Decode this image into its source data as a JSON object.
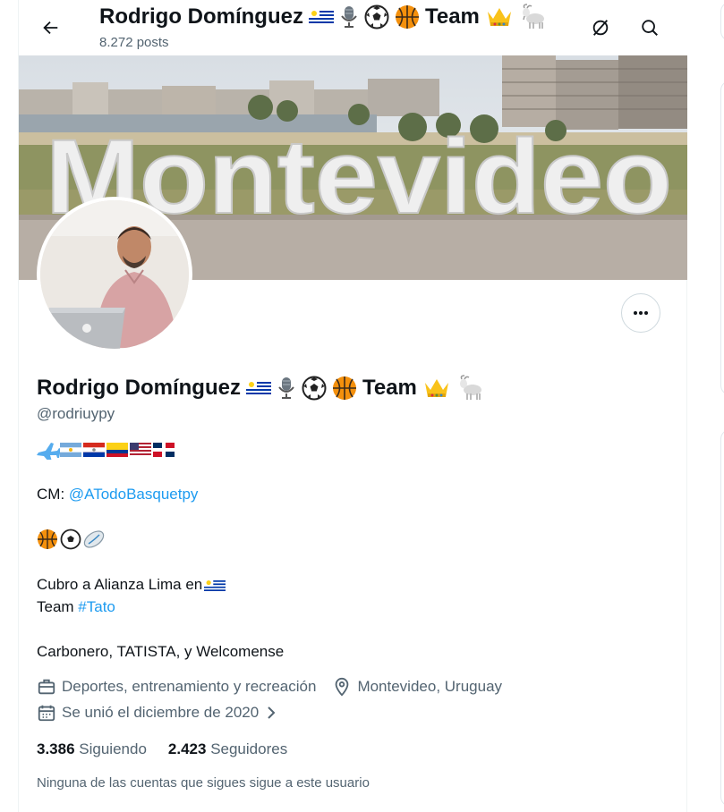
{
  "header": {
    "title_prefix": "Rodrigo Domínguez",
    "title_suffix": "Team",
    "posts": "8.272 posts"
  },
  "icons": {
    "back": "arrow-left-icon",
    "grok": "slash-circle-icon",
    "search": "search-icon",
    "more": "more-dots-icon",
    "category": "briefcase-icon",
    "location": "location-pin-icon",
    "joined": "calendar-icon"
  },
  "banner": {
    "text": "Montevideo"
  },
  "profile": {
    "name_prefix": "Rodrigo Domínguez",
    "name_suffix": "Team",
    "handle": "@rodriuypy"
  },
  "bio": {
    "cm_label": "CM: ",
    "cm_link": "@ATodoBasquetpy",
    "line_cubro": "Cubro a Alianza Lima en",
    "team_label": "Team ",
    "team_link": "#Tato",
    "line_carbonero": "Carbonero, TATISTA, y Welcomense"
  },
  "meta": {
    "category": "Deportes, entrenamiento y recreación",
    "location": "Montevideo, Uruguay",
    "joined": "Se unió el diciembre de 2020"
  },
  "stats": {
    "following_count": "3.386",
    "following_label": "Siguiendo",
    "followers_count": "2.423",
    "followers_label": "Seguidores"
  },
  "mutual": "Ninguna de las cuentas que sigues sigue a este usuario",
  "colors": {
    "accent": "#1d9bf0",
    "muted": "#536471",
    "text": "#0f1419"
  }
}
